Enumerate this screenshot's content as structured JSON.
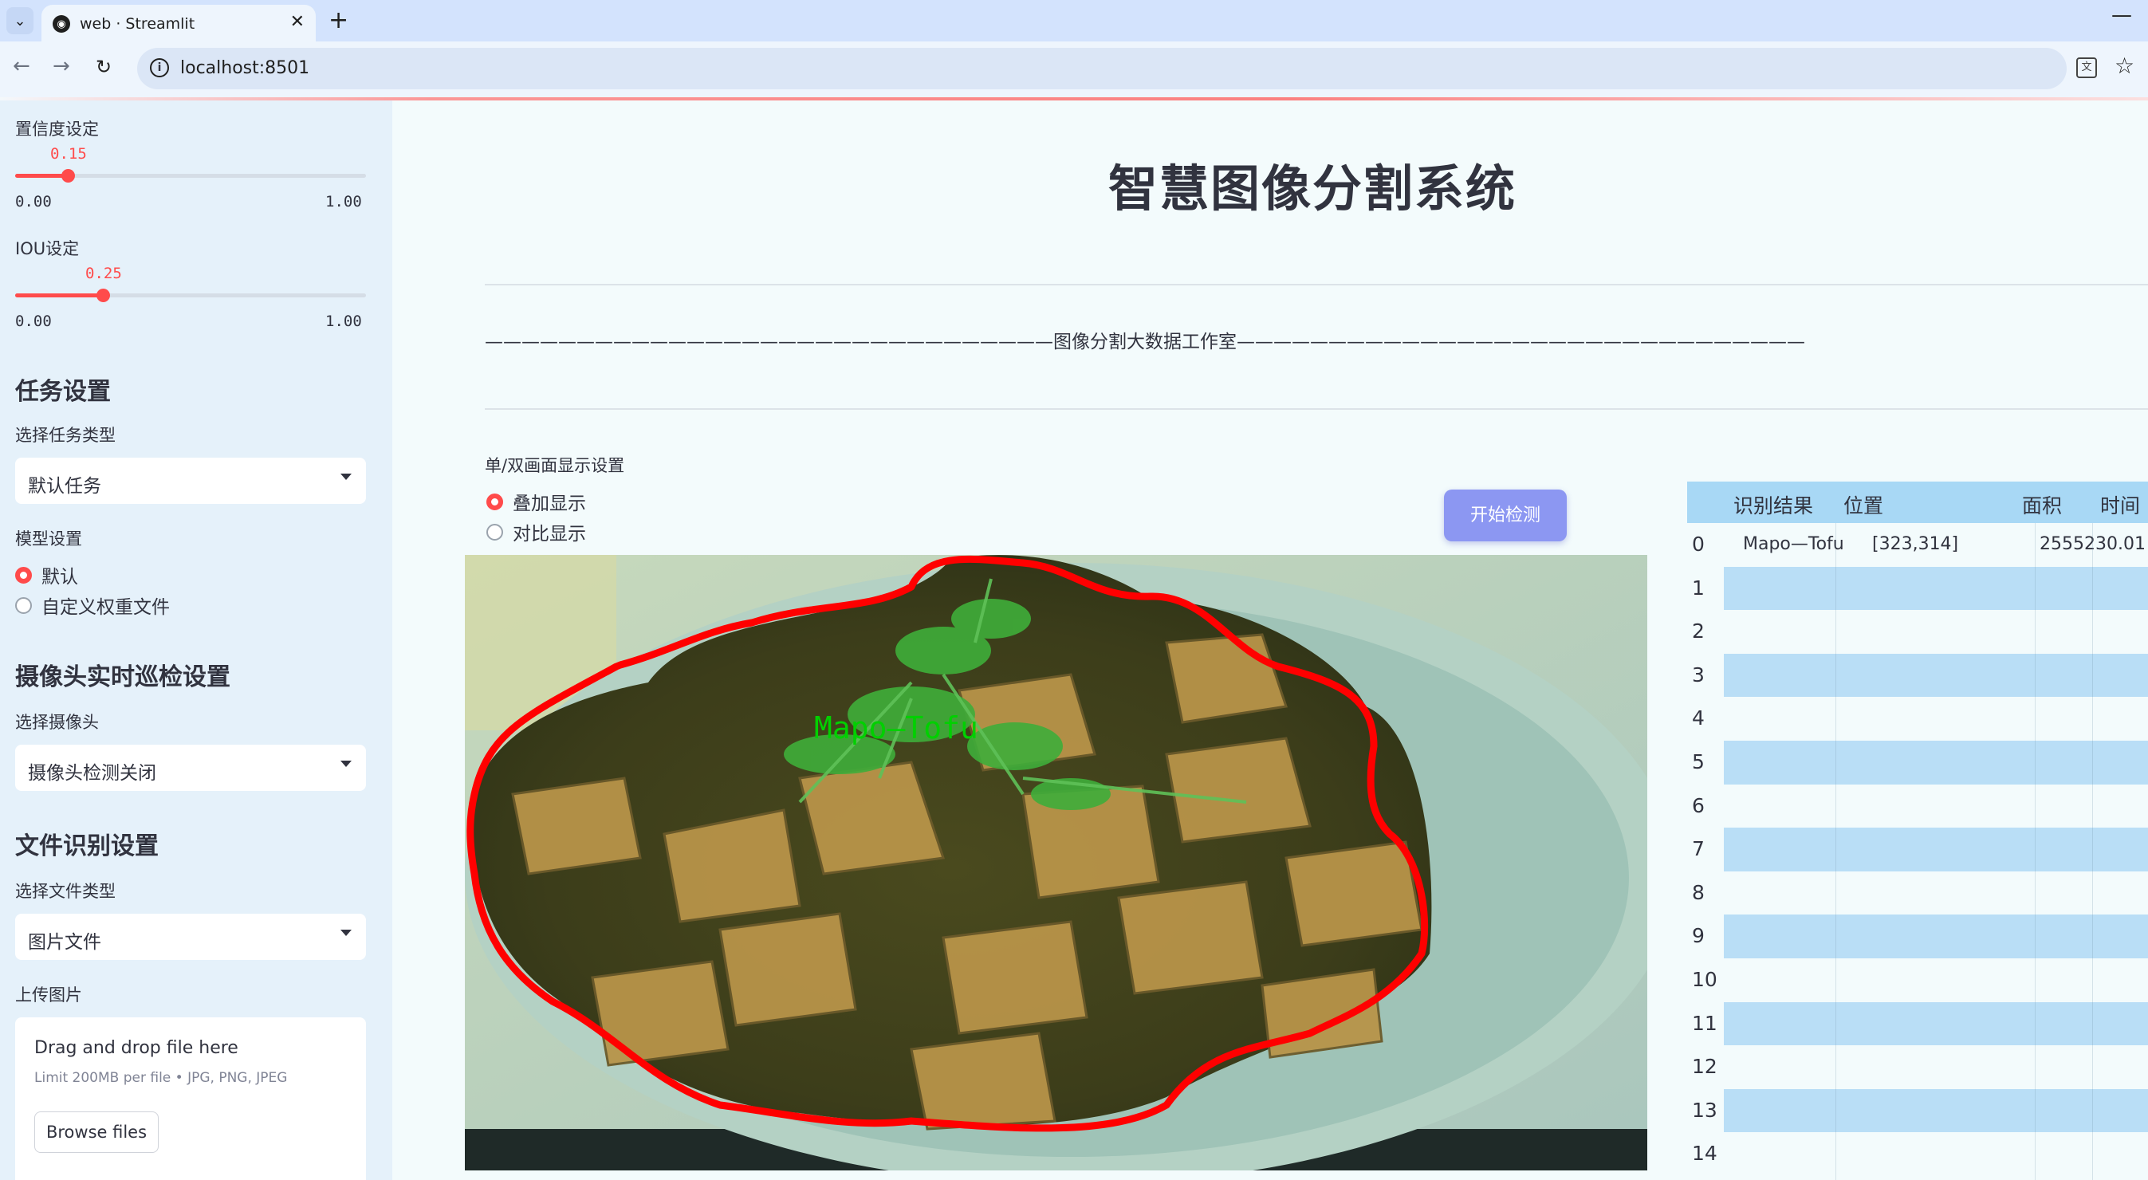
{
  "browser": {
    "tab_title": "web · Streamlit",
    "url": "localhost:8501"
  },
  "sidebar": {
    "confidence": {
      "label": "置信度设定",
      "value": "0.15",
      "min": "0.00",
      "max": "1.00",
      "fraction": 0.15
    },
    "iou": {
      "label": "IOU设定",
      "value": "0.25",
      "min": "0.00",
      "max": "1.00",
      "fraction": 0.25
    },
    "task": {
      "heading": "任务设置",
      "select_label": "选择任务类型",
      "selected": "默认任务"
    },
    "model": {
      "label": "模型设置",
      "options": [
        "默认",
        "自定义权重文件"
      ],
      "selected_index": 0
    },
    "camera": {
      "heading": "摄像头实时巡检设置",
      "select_label": "选择摄像头",
      "selected": "摄像头检测关闭"
    },
    "file": {
      "heading": "文件识别设置",
      "select_label": "选择文件类型",
      "selected": "图片文件"
    },
    "upload": {
      "label": "上传图片",
      "drop_text": "Drag and drop file here",
      "limit_text": "Limit 200MB per file • JPG, PNG, JPEG",
      "browse_label": "Browse files"
    }
  },
  "main": {
    "title": "智慧图像分割系统",
    "divider_text": "———————————————————————————————图像分割大数据工作室———————————————————————————————",
    "display_mode": {
      "label": "单/双画面显示设置",
      "options": [
        "叠加显示",
        "对比显示"
      ],
      "selected_index": 0
    },
    "start_button": "开始检测",
    "detection_label": "Mapo—Tofu",
    "colors": {
      "mask_outline": "#ff0000",
      "label_text": "#00d000",
      "accent": "#ff4b4b",
      "button": "#8c97f2"
    }
  },
  "table": {
    "columns": [
      "识别结果",
      "位置",
      "面积",
      "时间"
    ],
    "row_indices": [
      "0",
      "1",
      "2",
      "3",
      "4",
      "5",
      "6",
      "7",
      "8",
      "9",
      "10",
      "11",
      "12",
      "13",
      "14"
    ],
    "rows": [
      {
        "result": "Mapo—Tofu",
        "position": "[323,314]",
        "area": "2555230.01",
        "time": ""
      }
    ]
  }
}
